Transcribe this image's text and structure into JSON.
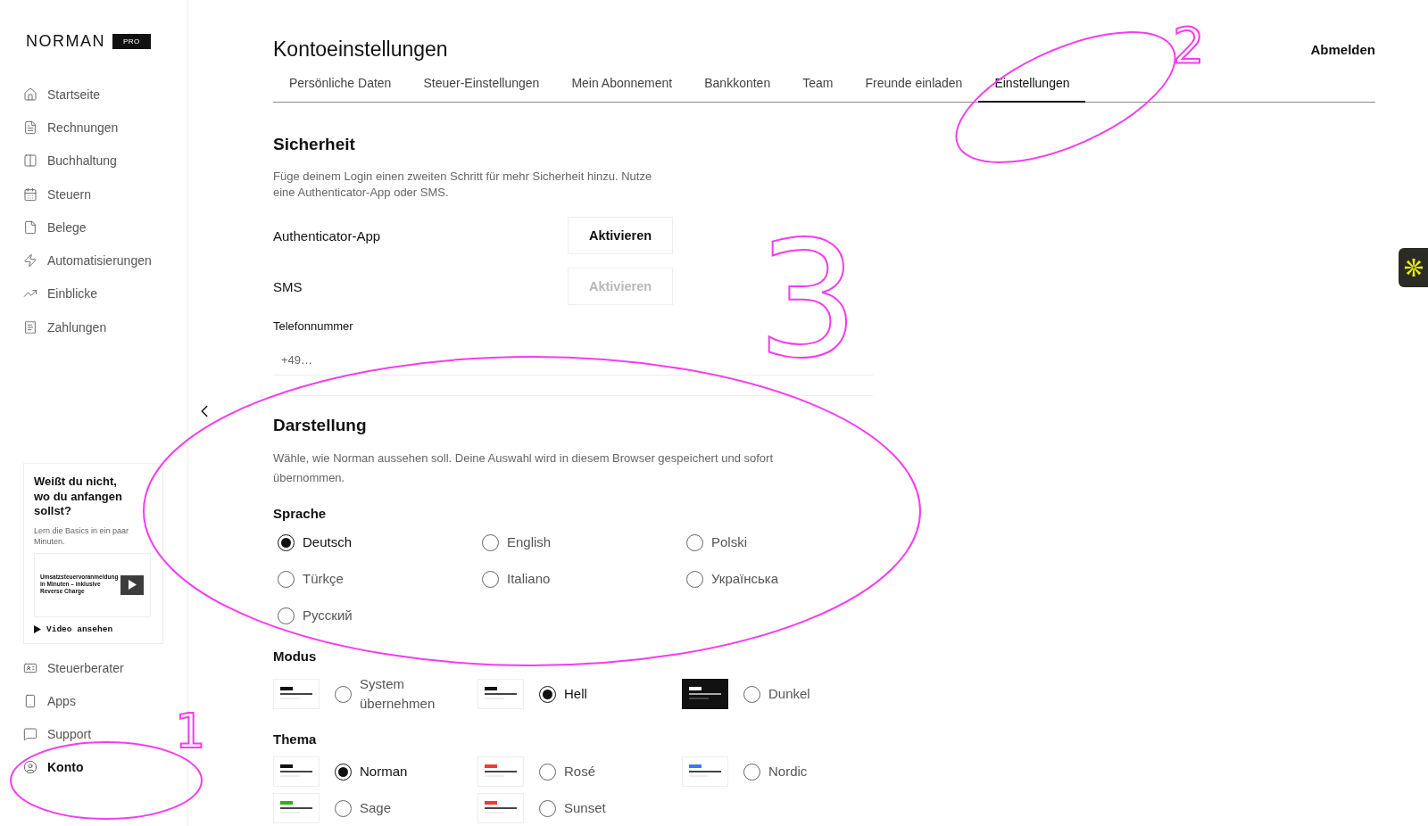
{
  "sidebar": {
    "logo": "NORMAN",
    "badge": "PRO",
    "items": [
      {
        "label": "Startseite",
        "selected": false
      },
      {
        "label": "Rechnungen",
        "selected": false
      },
      {
        "label": "Buchhaltung",
        "selected": false
      },
      {
        "label": "Steuern",
        "selected": false
      },
      {
        "label": "Belege",
        "selected": false
      },
      {
        "label": "Automatisierungen",
        "selected": false
      },
      {
        "label": "Einblicke",
        "selected": false
      },
      {
        "label": "Zahlungen",
        "selected": false
      }
    ],
    "promo": {
      "title": "Weißt du nicht, wo du anfangen sollst?",
      "text": "Lern die Basics in ein paar Minuten.",
      "video_title": "Umsatzsteuervoranmeldung in Minuten – inklusive Reverse Charge",
      "link": "Video ansehen"
    },
    "bottom_items": [
      {
        "label": "Steuerberater",
        "selected": false
      },
      {
        "label": "Apps",
        "selected": false
      },
      {
        "label": "Support",
        "selected": false
      },
      {
        "label": "Konto",
        "selected": true
      }
    ]
  },
  "header": {
    "title": "Kontoeinstellungen",
    "logout": "Abmelden"
  },
  "tabs": [
    {
      "label": "Persönliche Daten",
      "selected": false
    },
    {
      "label": "Steuer-Einstellungen",
      "selected": false
    },
    {
      "label": "Mein Abonnement",
      "selected": false
    },
    {
      "label": "Bankkonten",
      "selected": false
    },
    {
      "label": "Team",
      "selected": false
    },
    {
      "label": "Freunde einladen",
      "selected": false
    },
    {
      "label": "Einstellungen",
      "selected": true
    }
  ],
  "security": {
    "title": "Sicherheit",
    "text": "Füge deinem Login einen zweiten Schritt für mehr Sicherheit hinzu. Nutze eine Authenticator-App oder SMS.",
    "methods": [
      {
        "label": "Authenticator-App",
        "button": "Aktivieren",
        "disabled": false
      },
      {
        "label": "SMS",
        "button": "Aktivieren",
        "disabled": true
      }
    ],
    "phone": {
      "label": "Telefonnummer",
      "placeholder": "+49…"
    }
  },
  "appearance": {
    "title": "Darstellung",
    "text": "Wähle, wie Norman aussehen soll. Deine Auswahl wird in diesem Browser gespeichert und sofort übernommen.",
    "language": {
      "title": "Sprache",
      "options": [
        {
          "label": "Deutsch",
          "selected": true
        },
        {
          "label": "English",
          "selected": false
        },
        {
          "label": "Polski",
          "selected": false
        },
        {
          "label": "Türkçe",
          "selected": false
        },
        {
          "label": "Italiano",
          "selected": false
        },
        {
          "label": "Українська",
          "selected": false
        },
        {
          "label": "Русский",
          "selected": false
        }
      ]
    },
    "mode": {
      "title": "Modus",
      "options": [
        {
          "label": "System übernehmen",
          "kind": "system",
          "selected": false
        },
        {
          "label": "Hell",
          "kind": "light",
          "selected": true
        },
        {
          "label": "Dunkel",
          "kind": "dark",
          "selected": false
        }
      ]
    },
    "theme": {
      "title": "Thema",
      "options": [
        {
          "label": "Norman",
          "color": "#111111",
          "selected": true
        },
        {
          "label": "Rosé",
          "color": "#f23a3a",
          "selected": false
        },
        {
          "label": "Nordic",
          "color": "#3b7be8",
          "selected": false
        },
        {
          "label": "Sage",
          "color": "#3aaa1e",
          "selected": false
        },
        {
          "label": "Sunset",
          "color": "#f23a3a",
          "selected": false
        }
      ]
    }
  },
  "annotations": [
    {
      "number": "1"
    },
    {
      "number": "2"
    },
    {
      "number": "3"
    }
  ]
}
